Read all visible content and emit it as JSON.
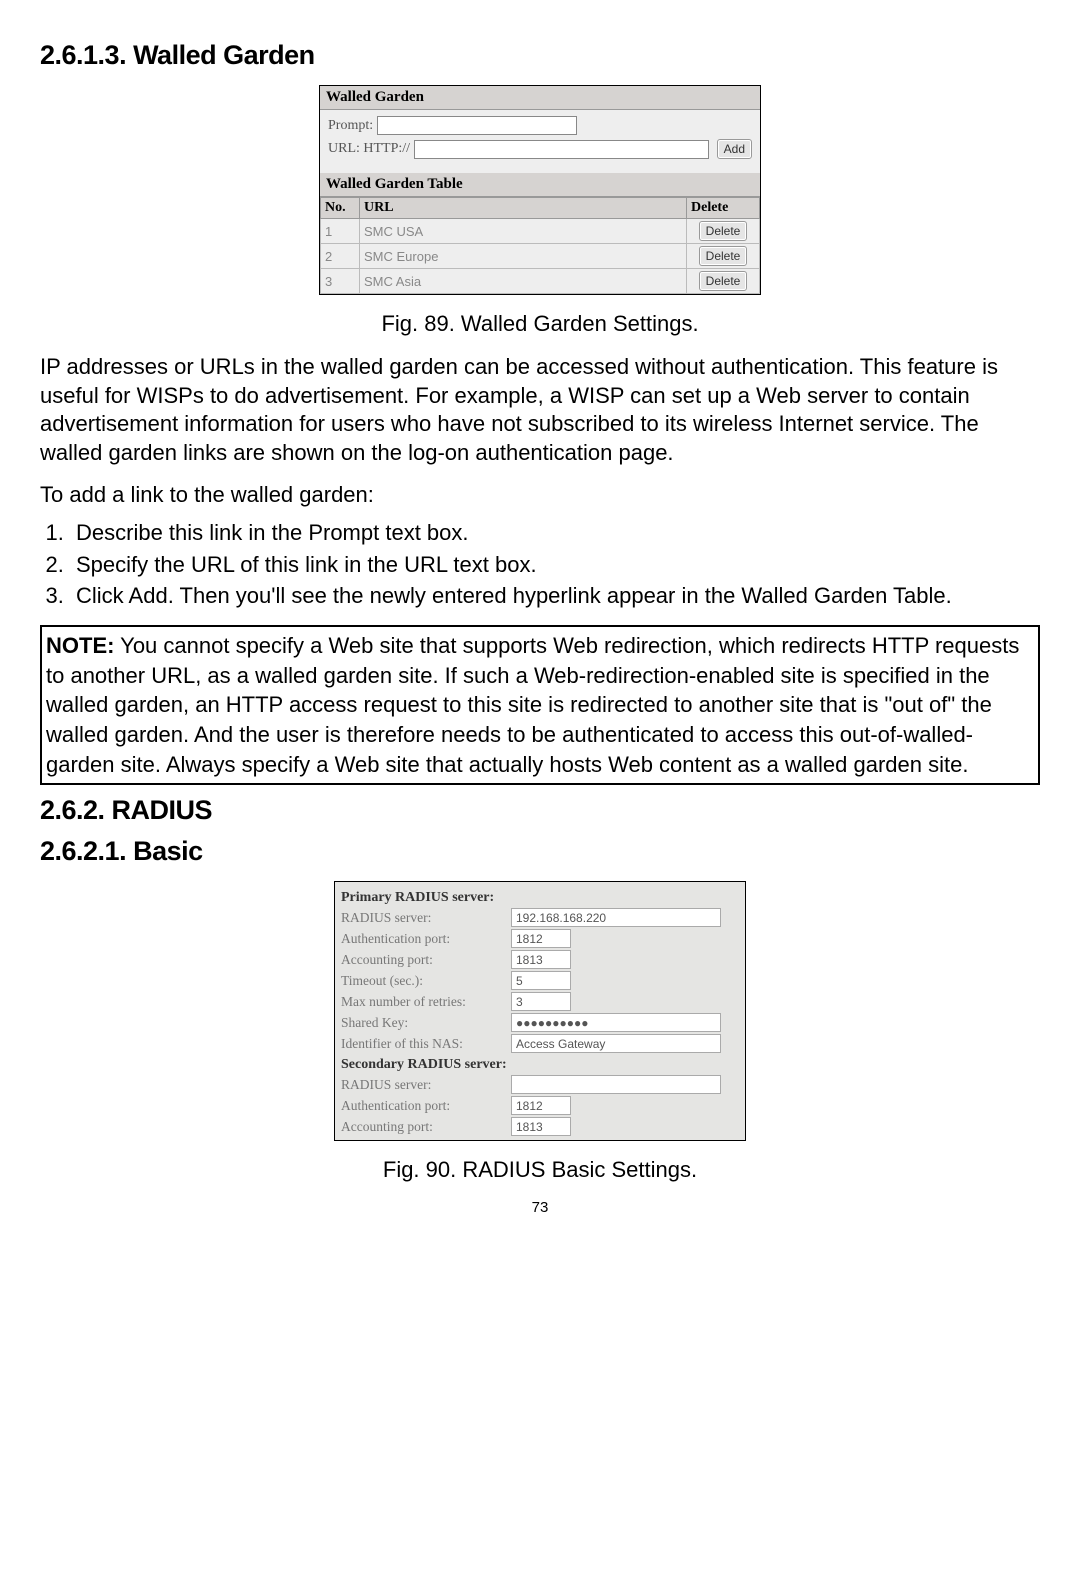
{
  "headings": {
    "h_walled": "2.6.1.3. Walled Garden",
    "h_radius": "2.6.2. RADIUS",
    "h_basic": "2.6.2.1. Basic"
  },
  "fig89": {
    "caption": "Fig. 89. Walled Garden Settings.",
    "panel_title": "Walled Garden",
    "prompt_label": "Prompt:",
    "url_label": "URL: HTTP://",
    "add_btn": "Add",
    "table_title": "Walled Garden Table",
    "cols": {
      "no": "No.",
      "url": "URL",
      "del": "Delete"
    },
    "rows": [
      {
        "no": "1",
        "url": "SMC USA",
        "del": "Delete"
      },
      {
        "no": "2",
        "url": "SMC Europe",
        "del": "Delete"
      },
      {
        "no": "3",
        "url": "SMC Asia",
        "del": "Delete"
      }
    ]
  },
  "para1": "IP addresses or URLs in the walled garden can be accessed without authentication. This feature is useful for WISPs to do advertisement. For example, a WISP can set up a Web server to contain advertisement information for users who have not subscribed to its wireless Internet service. The walled garden links are shown on the log-on authentication page.",
  "para2": "To add a link to the walled garden:",
  "steps": [
    "Describe this link in the Prompt text box.",
    "Specify the URL of this link in the URL text box.",
    "Click Add. Then you'll see the newly entered hyperlink appear in the Walled Garden Table."
  ],
  "note": {
    "label": "NOTE:",
    "text": " You cannot specify a Web site that supports Web redirection, which redirects HTTP requests to another URL, as a walled garden site. If such a Web-redirection-enabled site is specified in the walled garden, an HTTP access request to this site is redirected to another site that is \"out of\" the walled garden. And the user is therefore needs to be authenticated to access this out-of-walled-garden site. Always specify a Web site that actually hosts Web content as a walled garden site."
  },
  "fig90": {
    "caption": "Fig. 90. RADIUS Basic Settings.",
    "primary_hdr": "Primary RADIUS server:",
    "secondary_hdr": "Secondary RADIUS server:",
    "fields": {
      "server": "RADIUS server:",
      "auth": "Authentication port:",
      "acct": "Accounting port:",
      "timeout": "Timeout (sec.):",
      "retries": "Max number of retries:",
      "key": "Shared Key:",
      "nasid": "Identifier of this NAS:"
    },
    "primary": {
      "server": "192.168.168.220",
      "auth": "1812",
      "acct": "1813",
      "timeout": "5",
      "retries": "3",
      "key": "●●●●●●●●●●",
      "nasid": "Access Gateway"
    },
    "secondary": {
      "server": "",
      "auth": "1812",
      "acct": "1813"
    }
  },
  "page_no": "73"
}
